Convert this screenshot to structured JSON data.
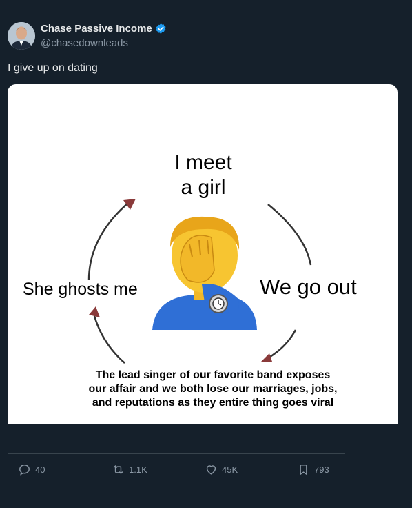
{
  "author": {
    "display_name": "Chase Passive Income",
    "handle": "@chasedownleads",
    "verified_icon": "verified-badge-icon",
    "verified_color": "#1d9bf0"
  },
  "tweet": {
    "text": "I give up on dating"
  },
  "media": {
    "meme": {
      "top": "I meet\na girl",
      "right": "We go out",
      "bottom": "The lead singer of our favorite band exposes our affair and we both lose our marriages, jobs, and reputations as they entire thing goes viral",
      "left": "She ghosts me",
      "center_icon": "facepalm-emoji-icon"
    }
  },
  "actions": {
    "reply": {
      "icon": "reply-icon",
      "count": "40"
    },
    "retweet": {
      "icon": "retweet-icon",
      "count": "1.1K"
    },
    "like": {
      "icon": "heart-icon",
      "count": "45K"
    },
    "bookmark": {
      "icon": "bookmark-icon",
      "count": "793"
    }
  }
}
